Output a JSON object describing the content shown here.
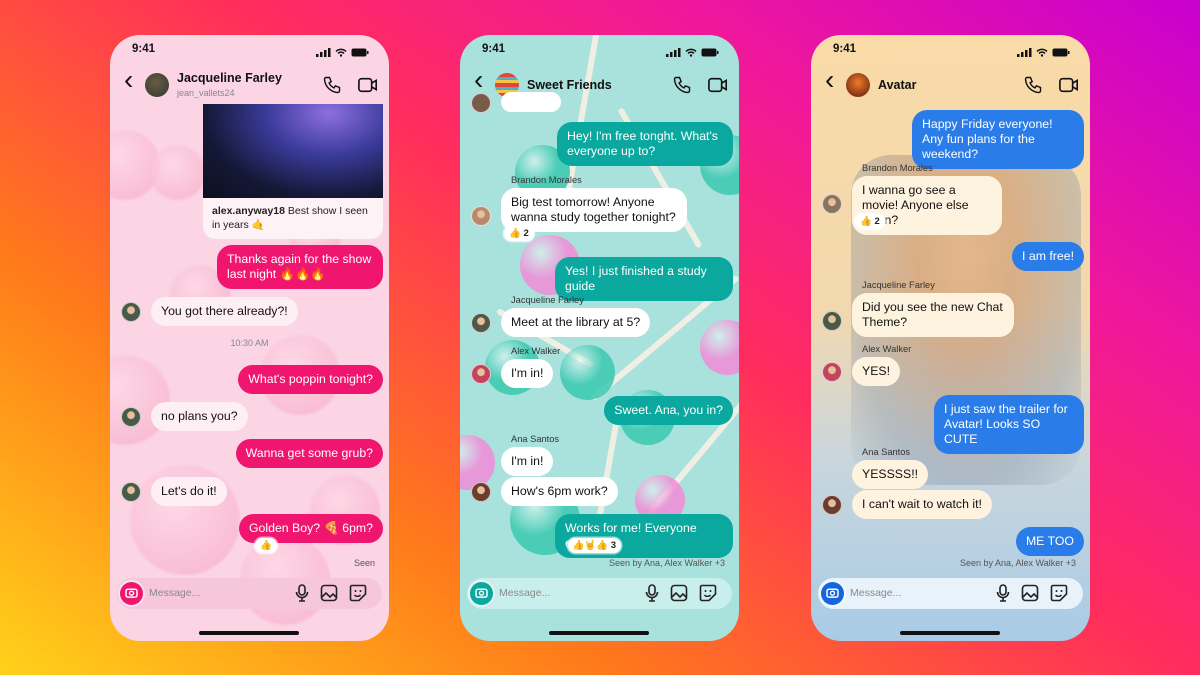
{
  "colors": {
    "background_gradient": [
      "#ffd21a",
      "#ff7a1a",
      "#ff2d5c",
      "#c800d0"
    ]
  },
  "phones": [
    {
      "theme": "hearts",
      "status_time": "9:41",
      "header": {
        "name": "Jacqueline Farley",
        "username": "jean_vallets24"
      },
      "colors": {
        "sent": "#f0166f",
        "received": "#fdeff4",
        "accent": "#f0166f",
        "input": "#f6c6da"
      },
      "shared_post": {
        "username": "alex.anyway18",
        "caption": "Best show I seen in years 🤙"
      },
      "messages": [
        {
          "type": "sent",
          "text": "Thanks again for the show last night 🔥🔥🔥"
        },
        {
          "type": "received",
          "text": "You got there already?!"
        },
        {
          "type": "time",
          "text": "10:30 AM"
        },
        {
          "type": "sent",
          "text": "What's poppin tonight?"
        },
        {
          "type": "received",
          "text": "no plans you?"
        },
        {
          "type": "sent",
          "text": "Wanna get some grub?"
        },
        {
          "type": "received",
          "text": "Let's do it!"
        },
        {
          "type": "sent",
          "text": "Golden Boy? 🍕 6pm?",
          "reaction": "👍"
        }
      ],
      "seen": "Seen",
      "input_placeholder": "Message..."
    },
    {
      "theme": "lollipops",
      "status_time": "9:41",
      "header": {
        "name": "Sweet Friends"
      },
      "colors": {
        "sent": "#0aa89e",
        "received": "#ffffff",
        "accent": "#0aa89e",
        "input": "#c9efec"
      },
      "messages": [
        {
          "type": "sent",
          "text": "Hey! I'm free tonght. What's everyone up to?"
        },
        {
          "type": "sender",
          "text": "Brandon Morales"
        },
        {
          "type": "received",
          "text": "Big test tomorrow! Anyone wanna study together tonight?",
          "reaction": "👍 2"
        },
        {
          "type": "sent",
          "text": "Yes! I just finished a study guide"
        },
        {
          "type": "sender",
          "text": "Jacqueline Farley"
        },
        {
          "type": "received",
          "text": "Meet at the library at 5?"
        },
        {
          "type": "sender",
          "text": "Alex Walker"
        },
        {
          "type": "received",
          "text": "I'm in!"
        },
        {
          "type": "sent",
          "text": "Sweet. Ana, you in?"
        },
        {
          "type": "sender",
          "text": "Ana Santos"
        },
        {
          "type": "received",
          "text": "I'm in!"
        },
        {
          "type": "received",
          "text": "How's 6pm work?"
        },
        {
          "type": "sent",
          "text": "Works for me! Everyone else?",
          "reaction": "👍🤘👍 3"
        }
      ],
      "seen": "Seen by Ana, Alex Walker +3",
      "input_placeholder": "Message..."
    },
    {
      "theme": "avatar",
      "status_time": "9:41",
      "header": {
        "name": "Avatar"
      },
      "colors": {
        "sent": "#2a7de8",
        "received": "#fdf3df",
        "accent": "#1565e0",
        "input": "#e8f2fb"
      },
      "messages": [
        {
          "type": "sent",
          "text": "Happy Friday everyone! Any fun plans for the weekend?"
        },
        {
          "type": "sender",
          "text": "Brandon Morales"
        },
        {
          "type": "received",
          "text": "I wanna go see a movie! Anyone else down?",
          "reaction": "👍 2"
        },
        {
          "type": "sent",
          "text": "I am free!"
        },
        {
          "type": "sender",
          "text": "Jacqueline Farley"
        },
        {
          "type": "received",
          "text": "Did you see the new Chat Theme?"
        },
        {
          "type": "sender",
          "text": "Alex Walker"
        },
        {
          "type": "received",
          "text": "YES!"
        },
        {
          "type": "sent",
          "text": "I just saw the trailer for Avatar! Looks SO CUTE"
        },
        {
          "type": "sender",
          "text": "Ana Santos"
        },
        {
          "type": "received",
          "text": "YESSSS!!"
        },
        {
          "type": "received",
          "text": "I can't wait to watch it!"
        },
        {
          "type": "sent",
          "text": "ME TOO"
        }
      ],
      "seen": "Seen by Ana, Alex Walker +3",
      "input_placeholder": "Message..."
    }
  ]
}
